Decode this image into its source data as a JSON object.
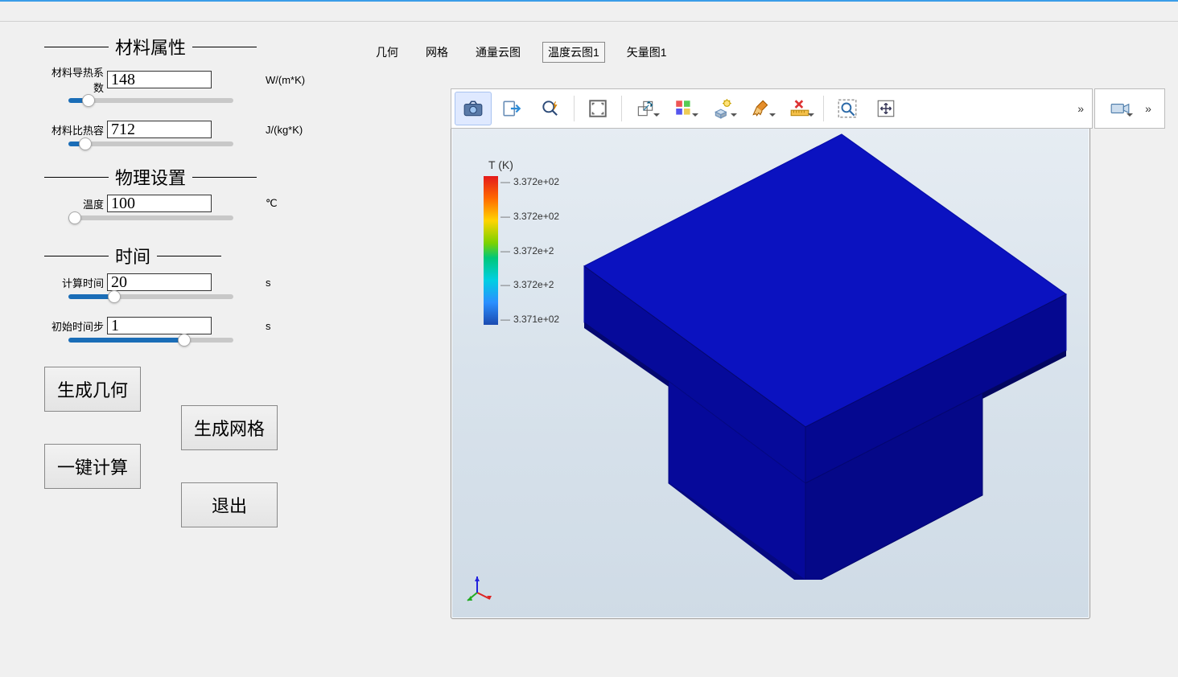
{
  "sections": {
    "material": {
      "title": "材料属性",
      "cond_label": "材料导热系数",
      "cond_value": "148",
      "cond_unit": "W/(m*K)",
      "heatcap_label": "材料比热容",
      "heatcap_value": "712",
      "heatcap_unit": "J/(kg*K)"
    },
    "physics": {
      "title": "物理设置",
      "temp_label": "温度",
      "temp_value": "100",
      "temp_unit": "℃"
    },
    "time": {
      "title": "时间",
      "calc_label": "计算时间",
      "calc_value": "20",
      "calc_unit": "s",
      "step_label": "初始时间步",
      "step_value": "1",
      "step_unit": "s"
    }
  },
  "buttons": {
    "gen_geom": "生成几何",
    "gen_mesh": "生成网格",
    "compute": "一键计算",
    "exit": "退出"
  },
  "tabs": {
    "geom": "几何",
    "mesh": "网格",
    "flux": "通量云图",
    "temp1": "温度云图1",
    "vect1": "矢量图1"
  },
  "legend": {
    "title": "T (K)",
    "ticks": [
      "3.372e+02",
      "3.372e+02",
      "3.372e+2",
      "3.372e+2",
      "3.371e+02"
    ]
  },
  "chart_data": {
    "type": "3d_scalar_field",
    "variable": "T",
    "unit": "K",
    "colormap": "rainbow",
    "range": [
      337.1,
      337.2
    ],
    "ticks": [
      337.2,
      337.2,
      337.2,
      337.2,
      337.1
    ],
    "tick_labels": [
      "3.372e+02",
      "3.372e+02",
      "3.372e+2",
      "3.372e+2",
      "3.371e+02"
    ],
    "geometry": "T-shaped solid block (wide slab on top of narrower base)",
    "rendered_color_hint": "near-uniform deep blue (values at low end of scale)"
  }
}
